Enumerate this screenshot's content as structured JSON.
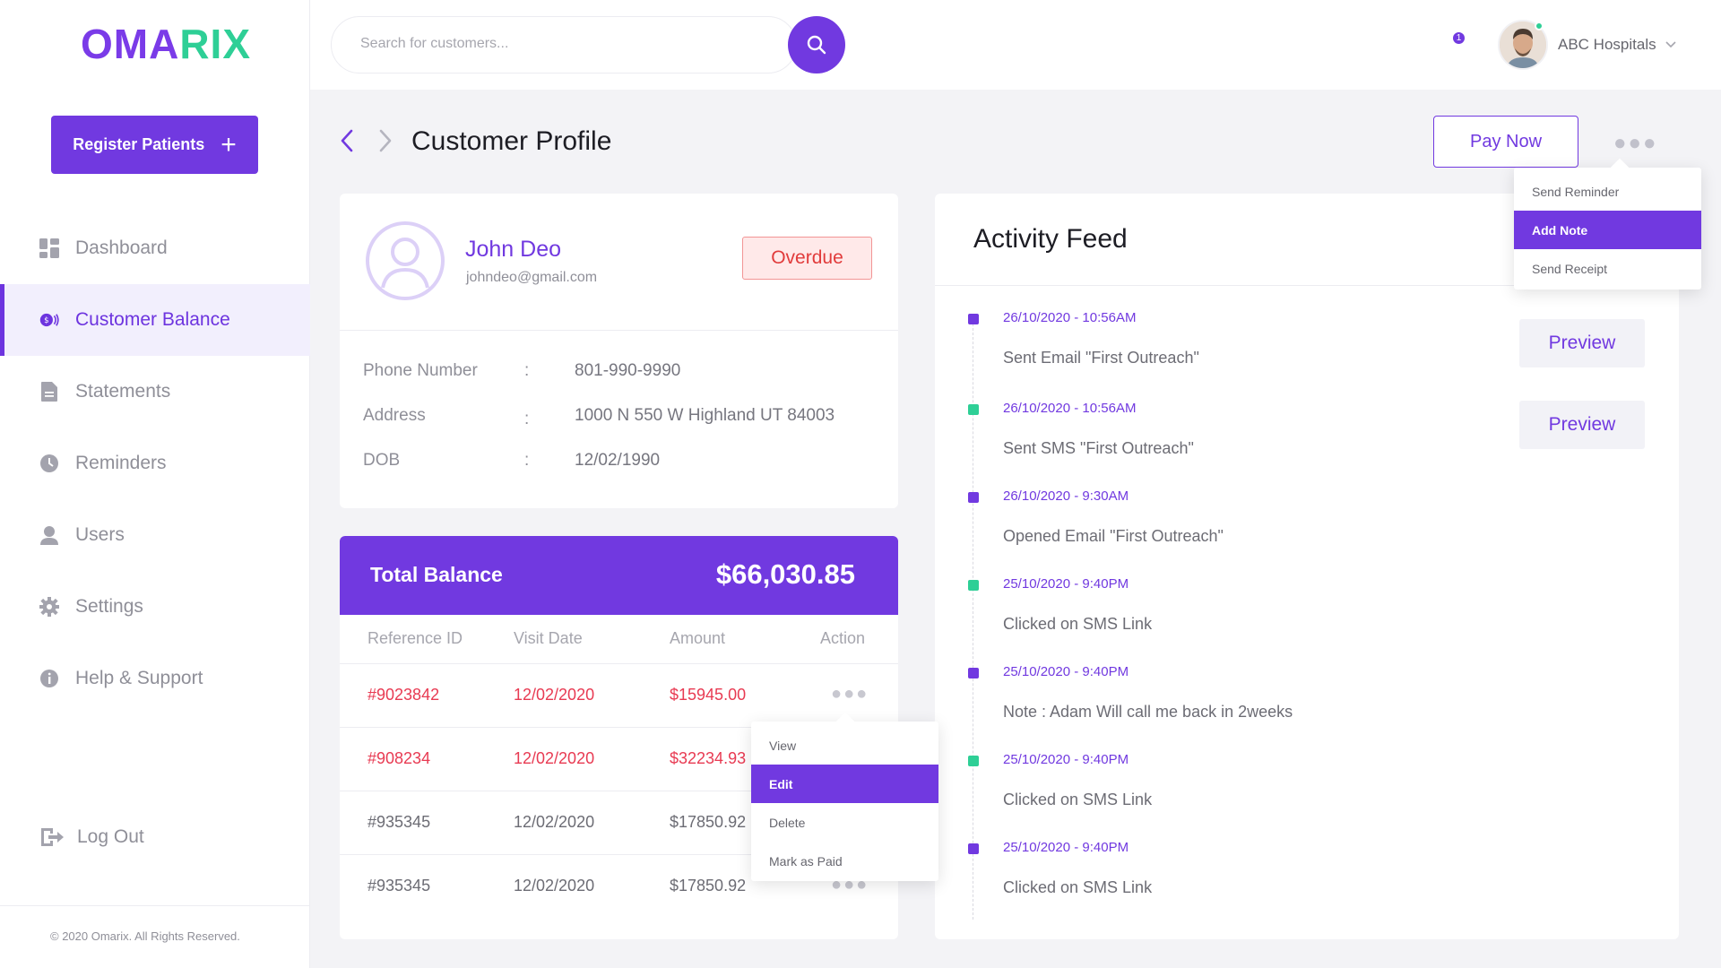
{
  "brand": {
    "logo_part1": "OMA",
    "logo_part2": "RIX"
  },
  "sidebar": {
    "register_label": "Register Patients",
    "items": [
      {
        "label": "Dashboard",
        "icon": "dashboard-icon"
      },
      {
        "label": "Customer Balance",
        "icon": "dollar-coin-icon",
        "active": true
      },
      {
        "label": "Statements",
        "icon": "document-icon"
      },
      {
        "label": "Reminders",
        "icon": "clock-icon"
      },
      {
        "label": "Users",
        "icon": "user-icon"
      },
      {
        "label": "Settings",
        "icon": "gear-icon"
      },
      {
        "label": "Help & Support",
        "icon": "info-icon"
      }
    ],
    "logout_label": "Log Out",
    "copyright": "© 2020 Omarix. All Rights Reserved."
  },
  "topbar": {
    "search_placeholder": "Search for customers...",
    "notification_count": "1",
    "account_name": "ABC Hospitals"
  },
  "header": {
    "title": "Customer Profile",
    "pay_now_label": "Pay Now",
    "more_menu": {
      "options": [
        "Send Reminder",
        "Add Note",
        "Send Receipt"
      ],
      "selected": "Add Note"
    }
  },
  "profile": {
    "name": "John Deo",
    "email": "johndeo@gmail.com",
    "status": "Overdue",
    "fields": [
      {
        "label": "Phone Number",
        "value": "801-990-9990"
      },
      {
        "label": "Address",
        "value": "1000 N 550 W Highland UT 84003"
      },
      {
        "label": "DOB",
        "value": "12/02/1990"
      }
    ]
  },
  "balance": {
    "title": "Total Balance",
    "amount": "$66,030.85",
    "columns": [
      "Reference ID",
      "Visit Date",
      "Amount",
      "Action"
    ],
    "rows": [
      {
        "ref": "#9023842",
        "date": "12/02/2020",
        "amount": "$15945.00",
        "overdue": true
      },
      {
        "ref": "#908234",
        "date": "12/02/2020",
        "amount": "$32234.93",
        "overdue": true
      },
      {
        "ref": "#935345",
        "date": "12/02/2020",
        "amount": "$17850.92",
        "overdue": false
      },
      {
        "ref": "#935345",
        "date": "12/02/2020",
        "amount": "$17850.92",
        "overdue": false
      }
    ],
    "row_menu": {
      "options": [
        "View",
        "Edit",
        "Delete",
        "Mark as Paid"
      ],
      "selected": "Edit"
    }
  },
  "activity": {
    "title": "Activity Feed",
    "preview_label": "Preview",
    "items": [
      {
        "date": "26/10/2020 - 10:56AM",
        "text": "Sent Email \"First Outreach\"",
        "color": "#7139e0"
      },
      {
        "date": "26/10/2020 - 10:56AM",
        "text": "Sent SMS \"First Outreach\"",
        "color": "#2ecf96"
      },
      {
        "date": "26/10/2020 - 9:30AM",
        "text": "Opened Email \"First Outreach\"",
        "color": "#7139e0"
      },
      {
        "date": "25/10/2020 - 9:40PM",
        "text": "Clicked on SMS Link",
        "color": "#2ecf96"
      },
      {
        "date": "25/10/2020 - 9:40PM",
        "text": "Note : Adam Will call me back in 2weeks",
        "color": "#7139e0"
      },
      {
        "date": "25/10/2020 - 9:40PM",
        "text": "Clicked on SMS Link",
        "color": "#2ecf96"
      },
      {
        "date": "25/10/2020 - 9:40PM",
        "text": "Clicked on SMS Link",
        "color": "#7139e0"
      }
    ]
  },
  "colors": {
    "accent": "#7139e0",
    "green": "#2ecf96",
    "overdue_red": "#e83a52"
  }
}
